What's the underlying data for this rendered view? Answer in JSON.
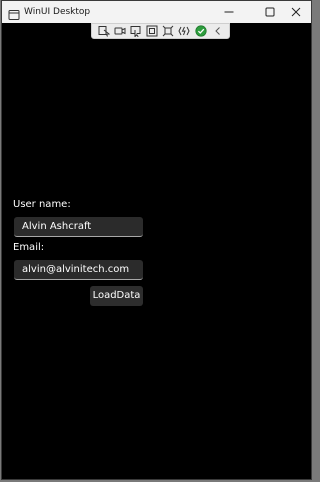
{
  "window": {
    "title": "WinUI Desktop"
  },
  "debug_toolbar": {
    "tools": [
      "select-element-icon",
      "video-icon",
      "pointer-icon",
      "focus-box-icon",
      "layout-icon",
      "hot-reload-icon",
      "check-icon",
      "collapse-chevron-icon"
    ]
  },
  "form": {
    "username_label": "User name:",
    "username_value": "Alvin Ashcraft",
    "email_label": "Email:",
    "email_value": "alvin@alvinitech.com",
    "load_button": "LoadData"
  },
  "colors": {
    "background": "#000000",
    "textbox": "#2b2b2b",
    "button": "#2d2d2d",
    "check_badge": "#2e9e3e"
  }
}
